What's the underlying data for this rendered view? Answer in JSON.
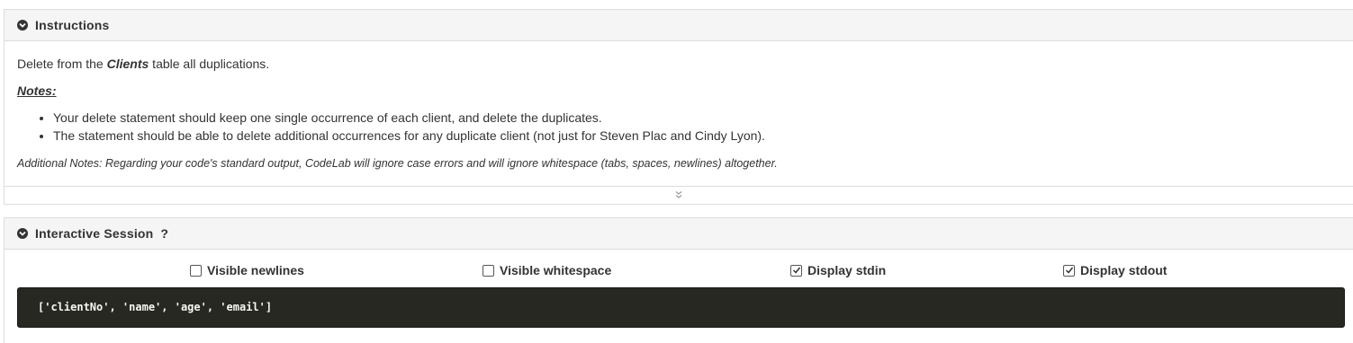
{
  "instructions": {
    "heading": "Instructions",
    "intro_before": "Delete from the ",
    "intro_table": "Clients",
    "intro_after": " table all duplications.",
    "notes_label": "Notes:",
    "notes": [
      "Your delete statement should keep one single occurrence of each client, and delete the duplicates.",
      "The statement should be able to delete additional occurrences for any duplicate client (not just for Steven Plac and Cindy Lyon)."
    ],
    "additional_notes": "Additional Notes: Regarding your code's standard output, CodeLab will ignore case errors and will ignore whitespace (tabs, spaces, newlines) altogether."
  },
  "session": {
    "heading": "Interactive Session",
    "help": "?",
    "options": [
      {
        "label": "Visible newlines",
        "checked": false
      },
      {
        "label": "Visible whitespace",
        "checked": false
      },
      {
        "label": "Display stdin",
        "checked": true
      },
      {
        "label": "Display stdout",
        "checked": true
      }
    ],
    "console_output": "['clientNo', 'name', 'age', 'email']"
  },
  "icons": {
    "collapse": "chevron-circle-down-icon",
    "expand": "double-chevron-down-icon"
  },
  "colors": {
    "console_bg": "#272822",
    "console_text": "#f8f8f2",
    "heading_bg": "#f5f5f5"
  }
}
